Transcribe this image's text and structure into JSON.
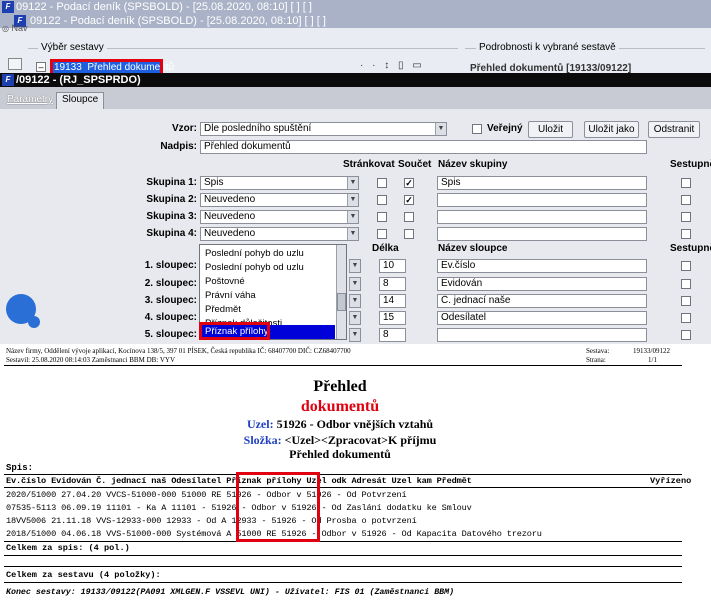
{
  "bg": {
    "title1": "09122 - Podací deník (SPSBOLD) - [25.08.2020, 08:10] [ ] [ ]",
    "title2": "09122 - Podací deník (SPSBOLD) - [25.08.2020, 08:10] [ ] [ ]",
    "nav_label": "Nav",
    "vyber_header": "Výběr sestavy",
    "selected_report_id": "19133",
    "selected_report_name": "Přehled dokumentů",
    "podrobnosti_header": "Podrobnosti k vybrané sestavě",
    "podrobnosti_value": "Přehled dokumentů [19133/09122]"
  },
  "dialog": {
    "title": "/09122 - (RJ_SPSPRDO)",
    "tabs": [
      "Parametry",
      "Sloupce"
    ],
    "vzor_label": "Vzor:",
    "vzor_value": "Dle posledního spuštění",
    "verejny_label": "Veřejný",
    "btn_ulozit": "Uložit",
    "btn_ulozit_jako": "Uložit jako",
    "btn_odstranit": "Odstranit",
    "nadpis_label": "Nadpis:",
    "nadpis_value": "Přehled dokumentů",
    "hdr_strankovat": "Stránkovat",
    "hdr_soucet": "Součet",
    "hdr_nazev_skupiny": "Název skupiny",
    "hdr_sestupne": "Sestupně",
    "groups": [
      {
        "label": "Skupina 1:",
        "value": "Spis",
        "strankovat": false,
        "soucet": true,
        "nazev": "Spis"
      },
      {
        "label": "Skupina 2:",
        "value": "Neuvedeno",
        "strankovat": false,
        "soucet": true,
        "nazev": ""
      },
      {
        "label": "Skupina 3:",
        "value": "Neuvedeno",
        "strankovat": false,
        "soucet": false,
        "nazev": ""
      },
      {
        "label": "Skupina 4:",
        "value": "Neuvedeno",
        "strankovat": false,
        "soucet": false,
        "nazev": ""
      }
    ],
    "hdr_delka": "Délka",
    "hdr_nazev_sloupce": "Název sloupce",
    "columns": [
      {
        "label": "1. sloupec:",
        "delka": "10",
        "nazev": "Ev.číslo"
      },
      {
        "label": "2. sloupec:",
        "delka": "8",
        "nazev": "Evidován"
      },
      {
        "label": "3. sloupec:",
        "delka": "14",
        "nazev": "Č. jednací naše"
      },
      {
        "label": "4. sloupec:",
        "delka": "15",
        "nazev": "Odesílatel"
      },
      {
        "label": "5. sloupec:",
        "delka": "8",
        "nazev": ""
      }
    ],
    "dropdown_options": [
      "Poslední pohyb do uzlu",
      "Poslední pohyb od uzlu",
      "Poštovné",
      "Právní váha",
      "Předmět",
      "Příznak důležitosti",
      "Příznak přílohy"
    ],
    "dropdown_selected": "Příznak přílohy"
  },
  "report": {
    "company_line": "Název firmy, Oddělení vývoje aplikací, Kocínova 138/5, 397 01 PÍSEK, Česká republika  IČ: 68407700  DIČ: CZ68407700",
    "sestavil_line": "Sestavil: 25.08.2020 08:14:03 Zaměstnanci BBM  DB: VYV",
    "sestava_label": "Sestava:",
    "sestava_value": "19133/09122",
    "strana_label": "Strana:",
    "strana_value": "1/1",
    "title_line1": "Přehled",
    "title_line2": "dokumentů",
    "uzel_label": "Uzel:",
    "uzel_value": "51926 - Odbor vnějších vztahů",
    "slozka_label": "Složka:",
    "slozka_value": "<Uzel><Zpracovat>K příjmu",
    "subtitle": "Přehled dokumentů",
    "spis_label": "Spis:",
    "table_header": "Ev.číslo   Evidován Č. jednací naš Odesílatel Příznak přílohy Uzel odk Adresát        Uzel kam        Předmět",
    "table_header_right": "Vyřízeno",
    "rows": [
      "2020/51000 27.04.20 VVCS-51000-000                            51000 RE 51926 - Odbor v 51926 - Od Potvrzení",
      "07535-5113 06.09.19                11101 - Ka A               11101 -  51926 - Odbor v 51926 - Od Zaslání dodatku ke Smlouv",
      "18VV5006   21.11.18 VVS-12933-000  12933 - Od A               12933 -                  51926 - Od Prosba o potvrzení",
      "2018/51000 04.06.18 VVS-51000-000  Systémová A                51000 RE 51926 - Odbor v 51926 - Od Kapacita Datového trezoru"
    ],
    "celkem_spis": "Celkem za spis:  (4 pol.)",
    "celkem_sestava": "Celkem za sestavu (4 položky):",
    "konec": "Konec sestavy: 19133/09122(PA091 XMLGEN.F VSSEVL UNI) - Uživatel: FIS 01 (Zaměstnanci BBM)"
  },
  "colors": {
    "title_bg": "#a9b2c7",
    "dialog_title_bg": "#0b0b0b",
    "highlight": "#0000d8",
    "red": "#e00010",
    "report_blue": "#1f3fbf"
  }
}
